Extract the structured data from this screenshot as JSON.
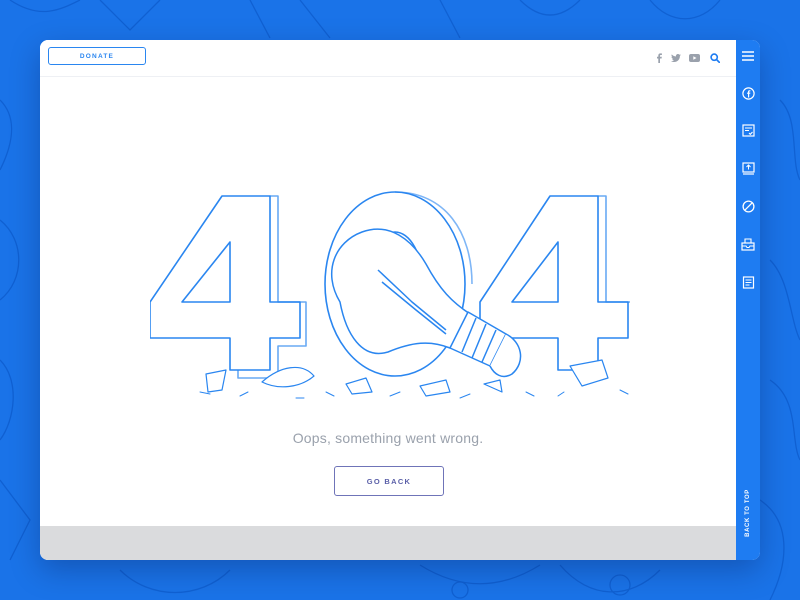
{
  "header": {
    "donate_label": "DONATE",
    "social": [
      "facebook-icon",
      "twitter-icon",
      "youtube-icon",
      "search-icon"
    ]
  },
  "main": {
    "error_code": "404",
    "message": "Oops, something went wrong.",
    "go_back_label": "GO BACK"
  },
  "sidebar": {
    "items": [
      "menu-icon",
      "facebook-circle-icon",
      "document-check-icon",
      "monitor-upload-icon",
      "block-icon",
      "inbox-icon",
      "article-icon"
    ],
    "back_to_top_label": "BACK TO TOP"
  },
  "colors": {
    "background": "#1a73e8",
    "accent": "#2a86f0",
    "sidebar": "#1e7cf2",
    "button_border": "#6f74b8",
    "footer": "#dadbdd"
  }
}
